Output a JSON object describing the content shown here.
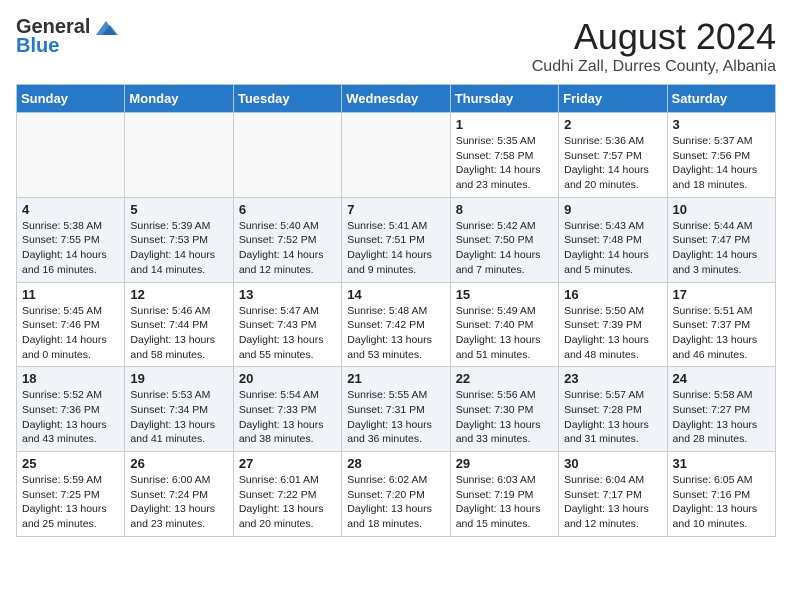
{
  "header": {
    "logo_general": "General",
    "logo_blue": "Blue",
    "month": "August 2024",
    "location": "Cudhi Zall, Durres County, Albania"
  },
  "days_of_week": [
    "Sunday",
    "Monday",
    "Tuesday",
    "Wednesday",
    "Thursday",
    "Friday",
    "Saturday"
  ],
  "weeks": [
    [
      {
        "day": "",
        "info": ""
      },
      {
        "day": "",
        "info": ""
      },
      {
        "day": "",
        "info": ""
      },
      {
        "day": "",
        "info": ""
      },
      {
        "day": "1",
        "info": "Sunrise: 5:35 AM\nSunset: 7:58 PM\nDaylight: 14 hours\nand 23 minutes."
      },
      {
        "day": "2",
        "info": "Sunrise: 5:36 AM\nSunset: 7:57 PM\nDaylight: 14 hours\nand 20 minutes."
      },
      {
        "day": "3",
        "info": "Sunrise: 5:37 AM\nSunset: 7:56 PM\nDaylight: 14 hours\nand 18 minutes."
      }
    ],
    [
      {
        "day": "4",
        "info": "Sunrise: 5:38 AM\nSunset: 7:55 PM\nDaylight: 14 hours\nand 16 minutes."
      },
      {
        "day": "5",
        "info": "Sunrise: 5:39 AM\nSunset: 7:53 PM\nDaylight: 14 hours\nand 14 minutes."
      },
      {
        "day": "6",
        "info": "Sunrise: 5:40 AM\nSunset: 7:52 PM\nDaylight: 14 hours\nand 12 minutes."
      },
      {
        "day": "7",
        "info": "Sunrise: 5:41 AM\nSunset: 7:51 PM\nDaylight: 14 hours\nand 9 minutes."
      },
      {
        "day": "8",
        "info": "Sunrise: 5:42 AM\nSunset: 7:50 PM\nDaylight: 14 hours\nand 7 minutes."
      },
      {
        "day": "9",
        "info": "Sunrise: 5:43 AM\nSunset: 7:48 PM\nDaylight: 14 hours\nand 5 minutes."
      },
      {
        "day": "10",
        "info": "Sunrise: 5:44 AM\nSunset: 7:47 PM\nDaylight: 14 hours\nand 3 minutes."
      }
    ],
    [
      {
        "day": "11",
        "info": "Sunrise: 5:45 AM\nSunset: 7:46 PM\nDaylight: 14 hours\nand 0 minutes."
      },
      {
        "day": "12",
        "info": "Sunrise: 5:46 AM\nSunset: 7:44 PM\nDaylight: 13 hours\nand 58 minutes."
      },
      {
        "day": "13",
        "info": "Sunrise: 5:47 AM\nSunset: 7:43 PM\nDaylight: 13 hours\nand 55 minutes."
      },
      {
        "day": "14",
        "info": "Sunrise: 5:48 AM\nSunset: 7:42 PM\nDaylight: 13 hours\nand 53 minutes."
      },
      {
        "day": "15",
        "info": "Sunrise: 5:49 AM\nSunset: 7:40 PM\nDaylight: 13 hours\nand 51 minutes."
      },
      {
        "day": "16",
        "info": "Sunrise: 5:50 AM\nSunset: 7:39 PM\nDaylight: 13 hours\nand 48 minutes."
      },
      {
        "day": "17",
        "info": "Sunrise: 5:51 AM\nSunset: 7:37 PM\nDaylight: 13 hours\nand 46 minutes."
      }
    ],
    [
      {
        "day": "18",
        "info": "Sunrise: 5:52 AM\nSunset: 7:36 PM\nDaylight: 13 hours\nand 43 minutes."
      },
      {
        "day": "19",
        "info": "Sunrise: 5:53 AM\nSunset: 7:34 PM\nDaylight: 13 hours\nand 41 minutes."
      },
      {
        "day": "20",
        "info": "Sunrise: 5:54 AM\nSunset: 7:33 PM\nDaylight: 13 hours\nand 38 minutes."
      },
      {
        "day": "21",
        "info": "Sunrise: 5:55 AM\nSunset: 7:31 PM\nDaylight: 13 hours\nand 36 minutes."
      },
      {
        "day": "22",
        "info": "Sunrise: 5:56 AM\nSunset: 7:30 PM\nDaylight: 13 hours\nand 33 minutes."
      },
      {
        "day": "23",
        "info": "Sunrise: 5:57 AM\nSunset: 7:28 PM\nDaylight: 13 hours\nand 31 minutes."
      },
      {
        "day": "24",
        "info": "Sunrise: 5:58 AM\nSunset: 7:27 PM\nDaylight: 13 hours\nand 28 minutes."
      }
    ],
    [
      {
        "day": "25",
        "info": "Sunrise: 5:59 AM\nSunset: 7:25 PM\nDaylight: 13 hours\nand 25 minutes."
      },
      {
        "day": "26",
        "info": "Sunrise: 6:00 AM\nSunset: 7:24 PM\nDaylight: 13 hours\nand 23 minutes."
      },
      {
        "day": "27",
        "info": "Sunrise: 6:01 AM\nSunset: 7:22 PM\nDaylight: 13 hours\nand 20 minutes."
      },
      {
        "day": "28",
        "info": "Sunrise: 6:02 AM\nSunset: 7:20 PM\nDaylight: 13 hours\nand 18 minutes."
      },
      {
        "day": "29",
        "info": "Sunrise: 6:03 AM\nSunset: 7:19 PM\nDaylight: 13 hours\nand 15 minutes."
      },
      {
        "day": "30",
        "info": "Sunrise: 6:04 AM\nSunset: 7:17 PM\nDaylight: 13 hours\nand 12 minutes."
      },
      {
        "day": "31",
        "info": "Sunrise: 6:05 AM\nSunset: 7:16 PM\nDaylight: 13 hours\nand 10 minutes."
      }
    ]
  ]
}
